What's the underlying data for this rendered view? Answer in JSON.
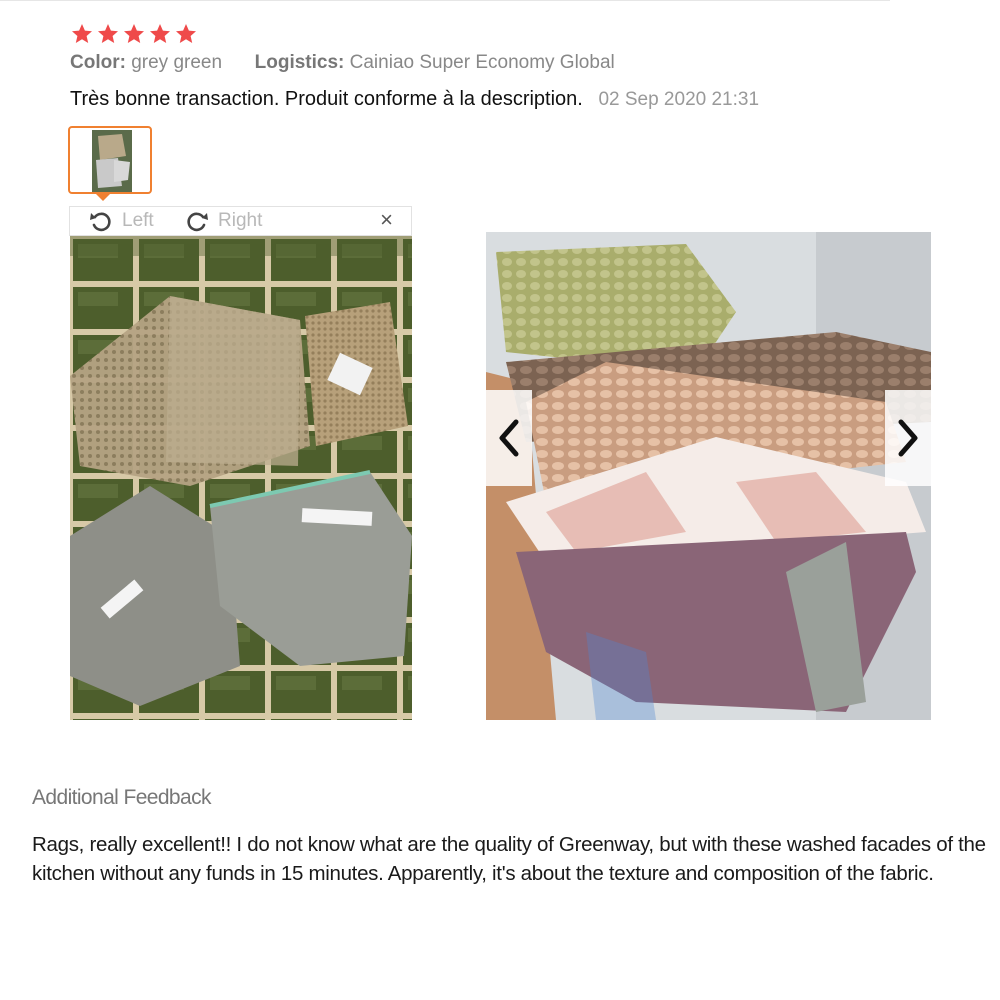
{
  "rating": {
    "stars": 5,
    "color": "#ef4a4a"
  },
  "meta": {
    "color_label": "Color:",
    "color_value": "grey green",
    "logistics_label": "Logistics:",
    "logistics_value": "Cainiao Super Economy Global"
  },
  "review": {
    "text": "Très bonne transaction. Produit conforme à la description.",
    "date": "02 Sep 2020 21:31"
  },
  "image_toolbar": {
    "left_label": "Left",
    "right_label": "Right",
    "close_symbol": "×",
    "accent": "#f08030"
  },
  "icons": [
    "rotate-left-icon",
    "rotate-right-icon",
    "close-icon",
    "chevron-left-icon",
    "chevron-right-icon",
    "star-icon"
  ],
  "additional_feedback": {
    "title": "Additional Feedback",
    "text": "Rags, really excellent!! I do not know what are the quality of Greenway, but with these washed facades of the kitchen without any funds in 15 minutes. Apparently, it's about the texture and composition of the fabric."
  }
}
